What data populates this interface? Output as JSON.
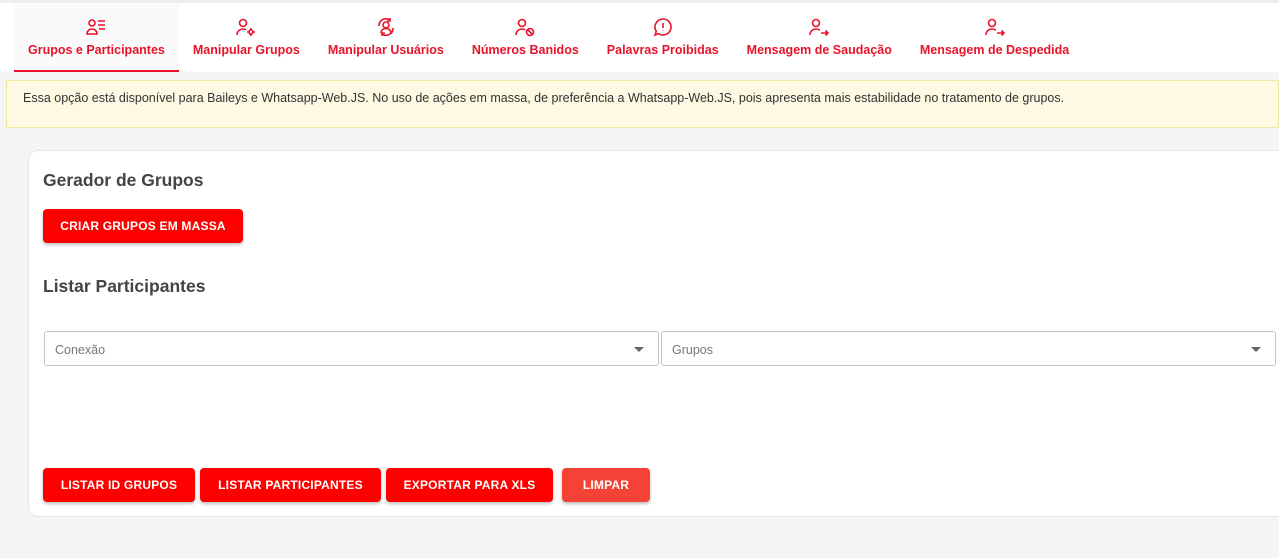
{
  "tabs": [
    {
      "label": "Grupos e Participantes",
      "icon": "user-list-icon",
      "active": true
    },
    {
      "label": "Manipular Grupos",
      "icon": "user-gear-icon",
      "active": false
    },
    {
      "label": "Manipular Usuários",
      "icon": "user-sync-icon",
      "active": false
    },
    {
      "label": "Números Banidos",
      "icon": "user-block-icon",
      "active": false
    },
    {
      "label": "Palavras Proibidas",
      "icon": "chat-alert-icon",
      "active": false
    },
    {
      "label": "Mensagem de Saudação",
      "icon": "user-arrow-icon",
      "active": false
    },
    {
      "label": "Mensagem de Despedida",
      "icon": "user-arrow-icon",
      "active": false
    }
  ],
  "alert": {
    "text": "Essa opção está disponível para Baileys e Whatsapp-Web.JS. No uso de ações em massa, de preferência a Whatsapp-Web.JS, pois apresenta mais estabilidade no tratamento de grupos."
  },
  "gerador": {
    "title": "Gerador de Grupos",
    "button": "CRIAR GRUPOS EM MASSA"
  },
  "listar": {
    "title": "Listar Participantes",
    "conexao_placeholder": "Conexão",
    "grupos_placeholder": "Grupos"
  },
  "actions": {
    "listar_id": "LISTAR ID GRUPOS",
    "listar_participantes": "LISTAR PARTICIPANTES",
    "exportar": "EXPORTAR PARA XLS",
    "limpar": "LIMPAR"
  },
  "colors": {
    "accent": "#e8132a",
    "button": "#ff0000",
    "button_light": "#f44336",
    "alert_bg": "#fdf9e3"
  }
}
